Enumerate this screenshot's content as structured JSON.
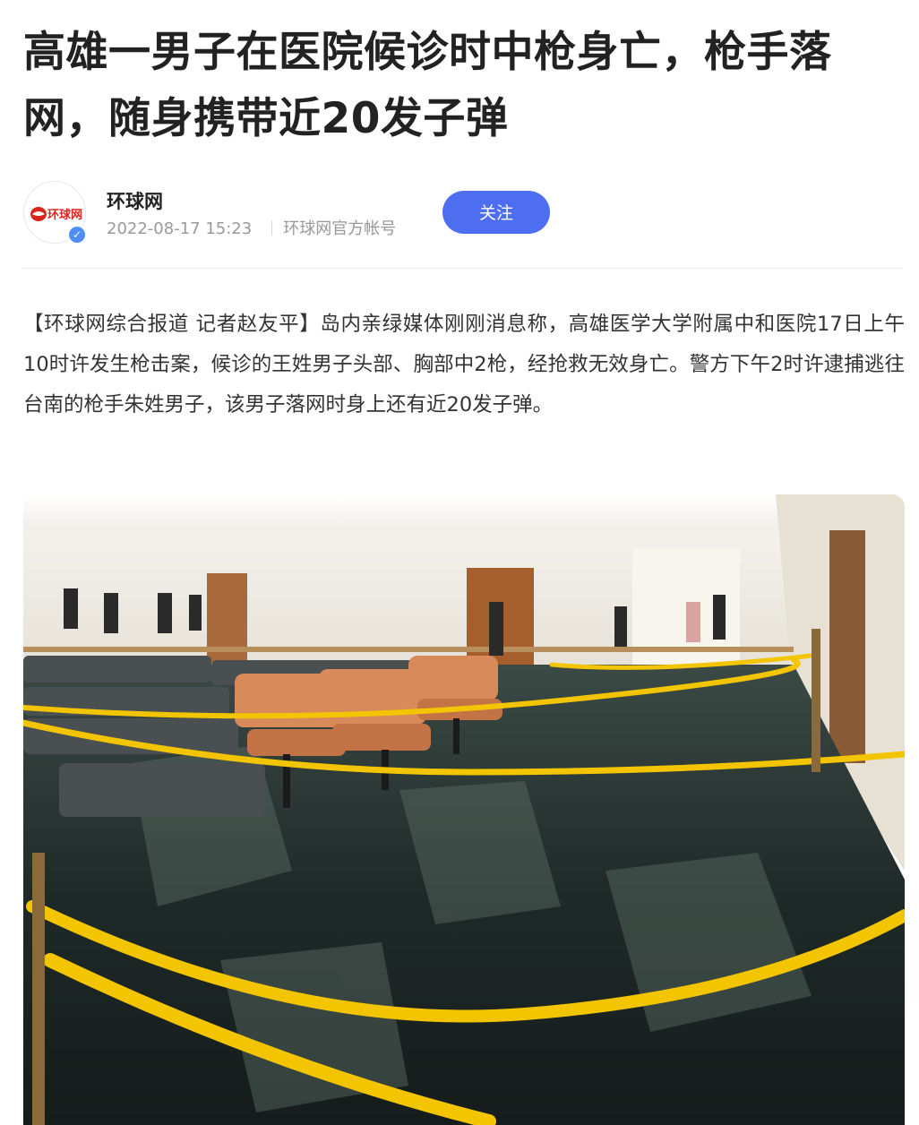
{
  "article": {
    "title": "高雄一男子在医院候诊时中枪身亡，枪手落网，随身携带近20发子弹",
    "author": {
      "name": "环球网",
      "avatar_logo_text": "环球网",
      "timestamp": "2022-08-17 15:23",
      "account_type": "环球网官方帐号",
      "verified_icon": "verified-check-icon",
      "follow_label": "关注"
    },
    "body": "【环球网综合报道 记者赵友平】岛内亲绿媒体刚刚消息称，高雄医学大学附属中和医院17日上午10时许发生枪击案，候诊的王姓男子头部、胸部中2枪，经抢救无效身亡。警方下午2时许逮捕逃往台南的枪手朱姓男子，该男子落网时身上还有近20发子弹。",
    "photo": {
      "subject": "hospital-waiting-area-cordoned-off-photo"
    }
  },
  "colors": {
    "follow_button": "#4e6ef2",
    "verified_badge": "#4e8ef7",
    "logo_red": "#d7261e",
    "title_text": "#222222",
    "meta_text": "#999999",
    "body_text": "#333333"
  }
}
